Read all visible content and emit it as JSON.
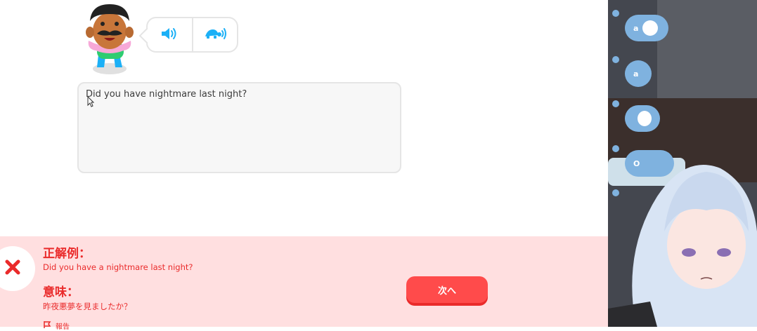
{
  "exercise": {
    "answer_text": "Did you have nightmare last night?"
  },
  "feedback": {
    "correct_heading": "正解例：",
    "correct_answer": "Did you have a nightmare last night?",
    "meaning_heading": "意味：",
    "meaning_text": "昨夜悪夢を見ましたか？",
    "report_label": "報告",
    "next_label": "次へ"
  },
  "stream_chat": {
    "messages": [
      {
        "name": "a"
      },
      {
        "name": "a"
      },
      {
        "name": ""
      },
      {
        "name": "O"
      }
    ]
  },
  "colors": {
    "error_red": "#ea2b2b",
    "feedback_bg": "#ffdfe0",
    "next_button": "#ff4b4b",
    "audio_blue": "#1cb0f6",
    "chat_bubble": "#7fb2df"
  },
  "icons": {
    "speaker": "speaker-icon",
    "slow_speaker": "turtle-icon",
    "wrong": "close-icon",
    "report": "flag-icon"
  }
}
